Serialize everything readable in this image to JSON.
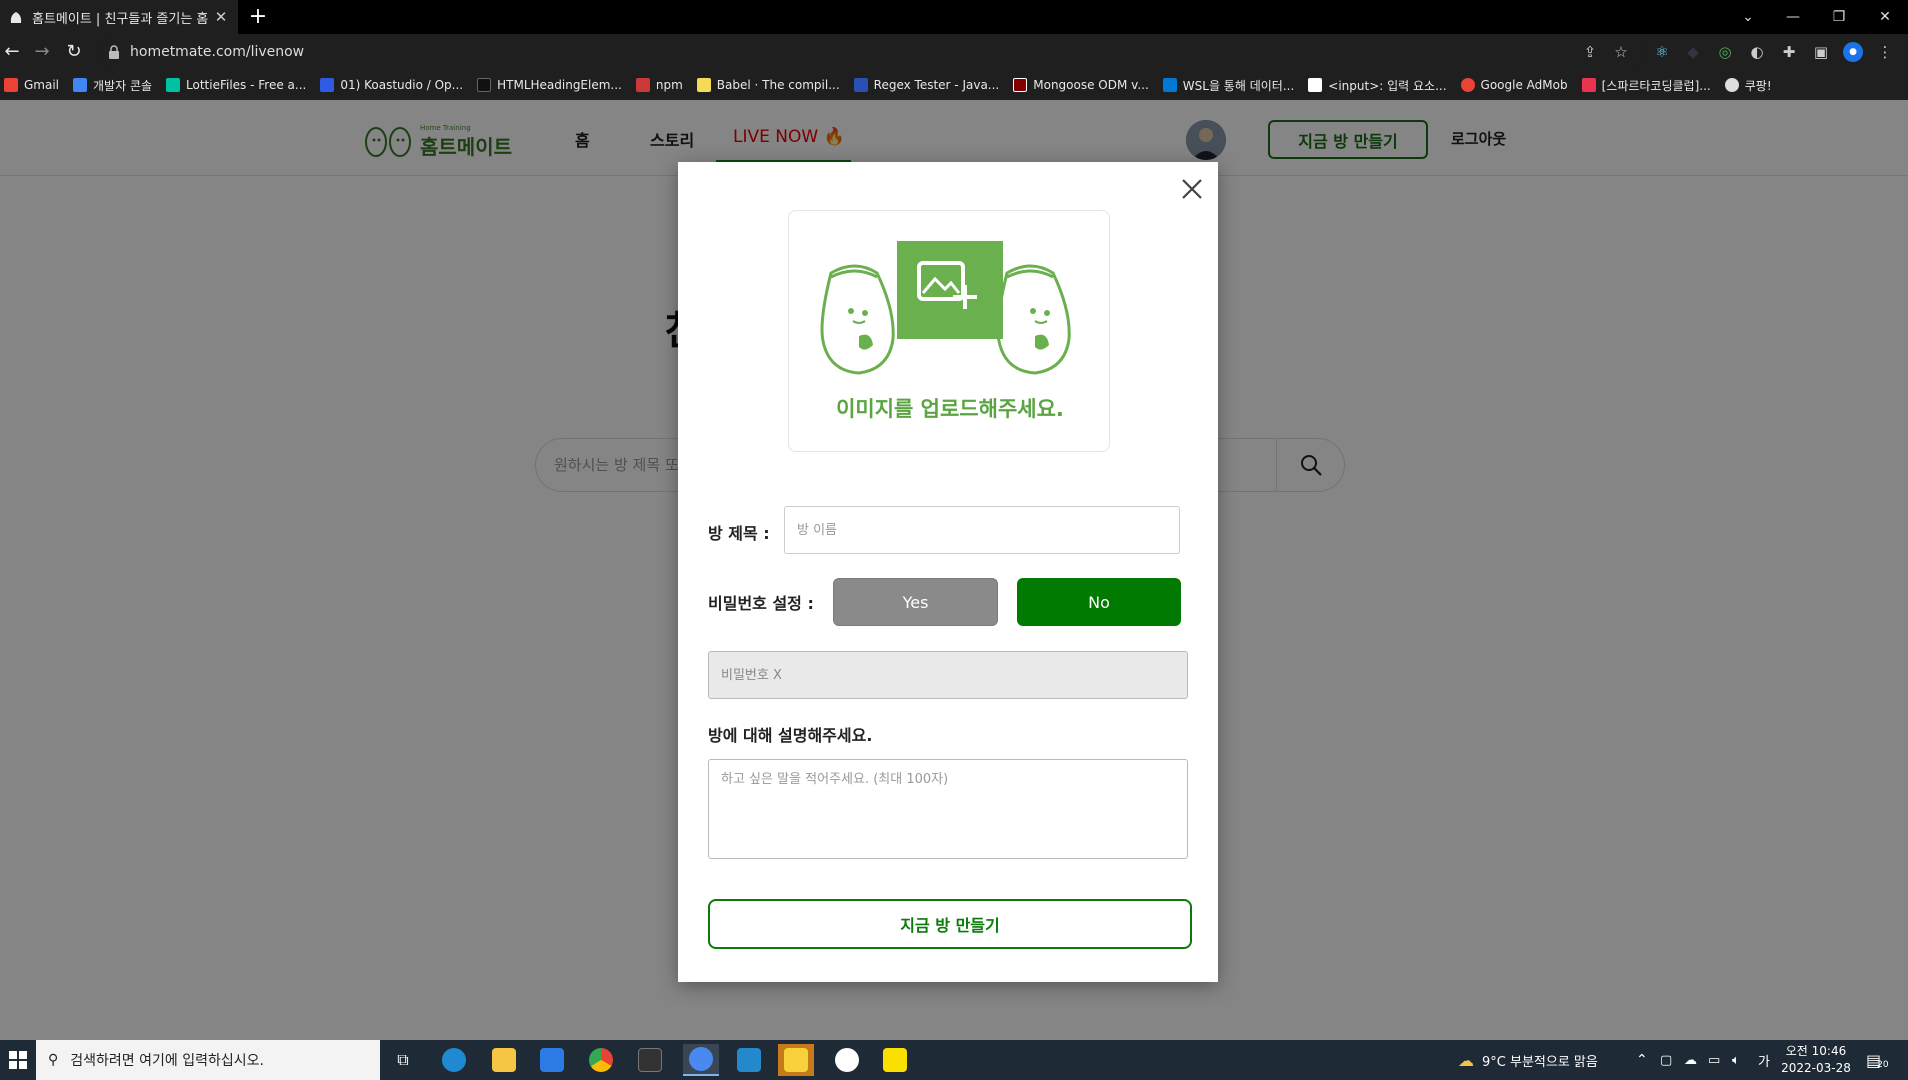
{
  "browser": {
    "tab_title": "홈트메이트 | 친구들과 즐기는 홈",
    "url": "hometmate.com/livenow",
    "bookmarks": [
      {
        "label": "Gmail",
        "color": "#ea4335"
      },
      {
        "label": "개발자 콘솔",
        "color": "#4285f4"
      },
      {
        "label": "LottieFiles - Free a...",
        "color": "#00c1a2"
      },
      {
        "label": "01) Koastudio / Op...",
        "color": "#2d5be3"
      },
      {
        "label": "HTMLHeadingElem...",
        "color": "#111111"
      },
      {
        "label": "npm",
        "color": "#cb3837"
      },
      {
        "label": "Babel · The compil...",
        "color": "#f5da55"
      },
      {
        "label": "Regex Tester - Java...",
        "color": "#2a4fb5"
      },
      {
        "label": "Mongoose ODM v...",
        "color": "#800000"
      },
      {
        "label": "WSL을 통해 데이터...",
        "color": "#0078d4"
      },
      {
        "label": "<input>: 입력 요소...",
        "color": "#ffffff"
      },
      {
        "label": "Google AdMob",
        "color": "#ea4335"
      },
      {
        "label": "[스파르타코딩클럽]...",
        "color": "#e8344e"
      },
      {
        "label": "쿠팡!",
        "color": "#dddddd"
      }
    ]
  },
  "site": {
    "logo_text": "홈트메이트",
    "logo_small": "Home Training",
    "nav": {
      "home": "홈",
      "story": "스토리",
      "live": "LIVE NOW 🔥"
    },
    "create_room": "지금 방 만들기",
    "logout": "로그아웃",
    "heading_fragment": "친",
    "search_placeholder": "원하시는 방 제목 또"
  },
  "modal": {
    "upload_text": "이미지를 업로드해주세요.",
    "title_label": "방 제목 :",
    "title_placeholder": "방 이름",
    "password_label": "비밀번호 설정 :",
    "yes_label": "Yes",
    "no_label": "No",
    "password_placeholder": "비밀번호 X",
    "desc_label": "방에 대해 설명해주세요.",
    "desc_placeholder": "하고 싶은 말을 적어주세요. (최대 100자)",
    "submit_label": "지금 방 만들기"
  },
  "taskbar": {
    "search_placeholder": "검색하려면 여기에 입력하십시오.",
    "weather": "9°C  부분적으로 맑음",
    "ime": "가",
    "time": "오전 10:46",
    "date": "2022-03-28",
    "notifications": "20"
  },
  "colors": {
    "brand_green": "#007a00",
    "accent_green_light": "#5aa542",
    "live_red": "#ee0000"
  }
}
